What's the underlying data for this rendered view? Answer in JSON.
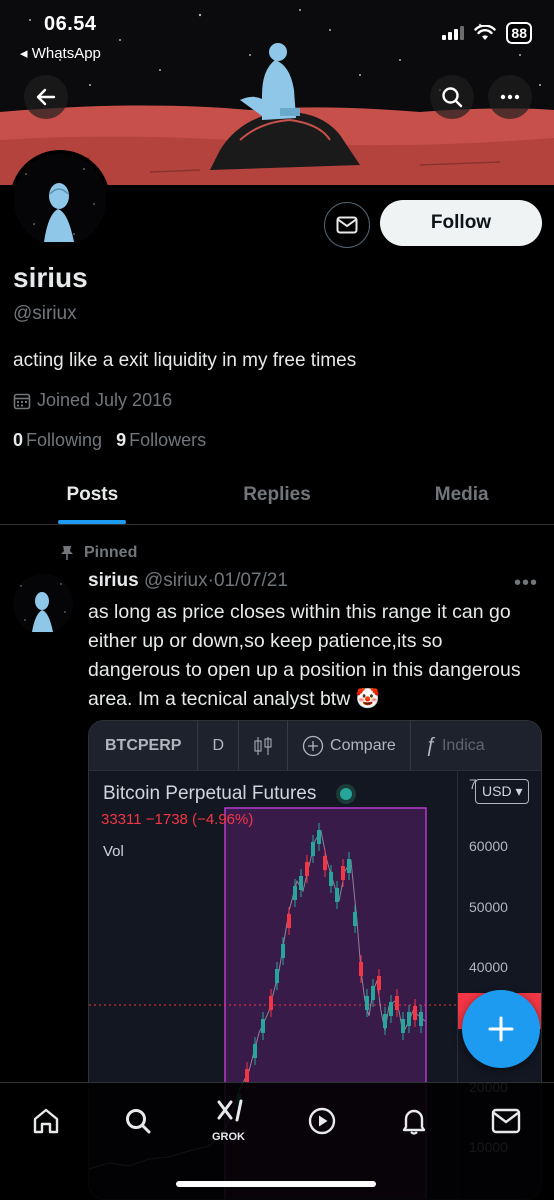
{
  "status_bar": {
    "time": "06.54",
    "back_app": "◂ WhatsApp",
    "battery": "88"
  },
  "header": {
    "back_icon": "arrow-left-icon",
    "search_icon": "search-icon",
    "more_icon": "more-icon"
  },
  "profile": {
    "name": "sirius",
    "handle": "@siriux",
    "bio": "acting like a exit liquidity in my free times",
    "joined": "Joined July 2016",
    "following_count": "0",
    "following_label": "Following",
    "followers_count": "9",
    "followers_label": "Followers",
    "follow_label": "Follow"
  },
  "tabs": [
    {
      "label": "Posts",
      "active": true
    },
    {
      "label": "Replies",
      "active": false
    },
    {
      "label": "Media",
      "active": false
    }
  ],
  "post": {
    "pinned_label": "Pinned",
    "author_name": "sirius",
    "author_handle": "@siriux",
    "separator": "·",
    "date": "01/07/21",
    "text": "as long as price closes within this range it can go either up or down,so keep patience,its so dangerous to open up a position in this dangerous area. Im a tecnical analyst btw 🤡",
    "chart": {
      "toolbar": {
        "symbol": "BTCPERP",
        "interval": "D",
        "compare": "Compare",
        "indicators": "Indica"
      },
      "title": "Bitcoin Perpetual Futures",
      "price_line": "33311  −1738 (−4.96%)",
      "vol_label": "Vol",
      "currency": "USD",
      "axis_labels": [
        "7",
        "60000",
        "50000",
        "40000",
        "20000",
        "10000"
      ]
    }
  },
  "bottom_nav": {
    "grok_label": "GROK",
    "items": [
      "home-icon",
      "search-icon",
      "grok-icon",
      "video-icon",
      "bell-icon",
      "mail-icon"
    ]
  },
  "colors": {
    "accent": "#1d9bf0",
    "banner_red": "#c8504a",
    "muted": "#71767b",
    "chart_down": "#f23645",
    "chart_up": "#26a69a",
    "highlight_box": "#9c27b0"
  }
}
